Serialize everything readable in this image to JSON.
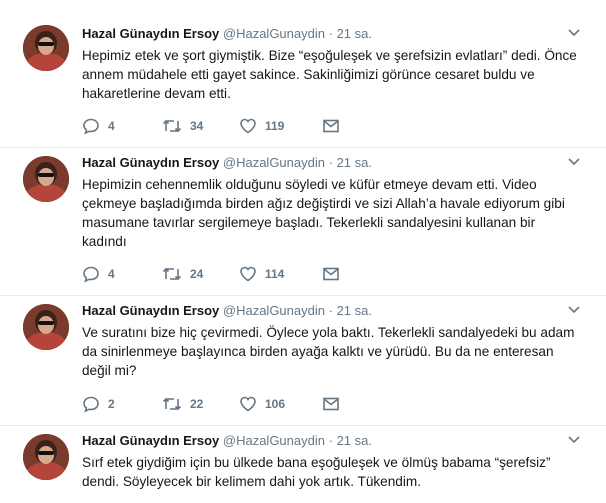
{
  "tweets": [
    {
      "fullname": "Hazal Günaydın Ersoy",
      "handle": "@HazalGunaydin",
      "separator": "·",
      "time": "21 sa.",
      "text": "Hepimiz etek ve şort giymiştik. Bize “eşoğuleşek ve şerefsizin evlatları” dedi. Önce\nannem müdahele etti gayet sakince. Sakinliğimizi görünce cesaret buldu ve\nhakaretlerine devam etti.",
      "replies": "4",
      "retweets": "34",
      "likes": "119"
    },
    {
      "fullname": "Hazal Günaydın Ersoy",
      "handle": "@HazalGunaydin",
      "separator": "·",
      "time": "21 sa.",
      "text": "Hepimizin cehennemlik olduğunu söyledi ve küfür etmeye devam etti. Video\nçekmeye başladığımda birden ağız değiştirdi ve sizi Allah’a havale ediyorum gibi\nmasumane tavırlar sergilemeye başladı. Tekerlekli sandalyesini kullanan bir\nkadındı",
      "replies": "4",
      "retweets": "24",
      "likes": "114"
    },
    {
      "fullname": "Hazal Günaydın Ersoy",
      "handle": "@HazalGunaydin",
      "separator": "·",
      "time": "21 sa.",
      "text": "Ve suratını bize hiç çevirmedi. Öylece yola baktı. Tekerlekli sandalyedeki bu adam\nda sinirlenmeye başlayınca birden ayağa kalktı ve yürüdü. Bu da ne enteresan\ndeğil mi?",
      "replies": "2",
      "retweets": "22",
      "likes": "106"
    },
    {
      "fullname": "Hazal Günaydın Ersoy",
      "handle": "@HazalGunaydin",
      "separator": "·",
      "time": "21 sa.",
      "text": "Sırf etek giydiğim için bu ülkede bana eşoğuleşek ve ölmüş babama “şerefsiz”\ndendi. Söyleyecek bir kelimem dahi yok artık. Tükendim."
    }
  ],
  "colors": {
    "text": "#14171a",
    "muted": "#657786",
    "divider": "#e6ecf0"
  },
  "icons": {
    "reply": "reply-icon",
    "retweet": "retweet-icon",
    "like": "heart-icon",
    "dm": "envelope-icon",
    "menu": "chevron-down-icon"
  }
}
